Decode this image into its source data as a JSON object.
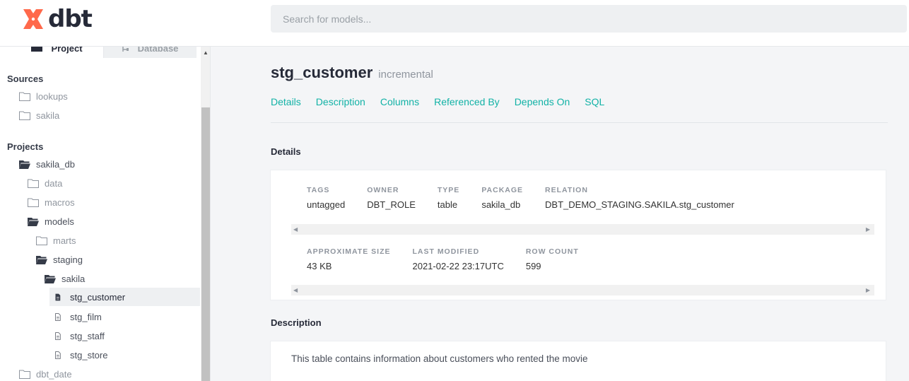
{
  "header": {
    "logo_text": "dbt",
    "search_placeholder": "Search for models..."
  },
  "sidebar": {
    "tabs": [
      {
        "label": "Project",
        "icon": "folder-icon"
      },
      {
        "label": "Database",
        "icon": "database-icon"
      }
    ],
    "sources_heading": "Sources",
    "sources": [
      "lookups",
      "sakila"
    ],
    "projects_heading": "Projects",
    "tree": {
      "sakila_db": "sakila_db",
      "data": "data",
      "macros": "macros",
      "models": "models",
      "marts": "marts",
      "staging": "staging",
      "sakila": "sakila",
      "stg_customer": "stg_customer",
      "stg_film": "stg_film",
      "stg_staff": "stg_staff",
      "stg_store": "stg_store",
      "dbt_date": "dbt_date"
    }
  },
  "main": {
    "model_name": "stg_customer",
    "model_type": "incremental",
    "nav": [
      "Details",
      "Description",
      "Columns",
      "Referenced By",
      "Depends On",
      "SQL"
    ],
    "details_title": "Details",
    "details": {
      "tags_label": "TAGS",
      "tags_value": "untagged",
      "owner_label": "OWNER",
      "owner_value": "DBT_ROLE",
      "type_label": "TYPE",
      "type_value": "table",
      "package_label": "PACKAGE",
      "package_value": "sakila_db",
      "relation_label": "RELATION",
      "relation_value": "DBT_DEMO_STAGING.SAKILA.stg_customer",
      "size_label": "APPROXIMATE SIZE",
      "size_value": "43 KB",
      "modified_label": "LAST MODIFIED",
      "modified_value": "2021-02-22 23:17UTC",
      "rows_label": "ROW COUNT",
      "rows_value": "599"
    },
    "description_title": "Description",
    "description_text": "This table contains information about customers who rented the movie"
  },
  "colors": {
    "accent": "#12b2a6",
    "brand": "#ff694b",
    "text_dark": "#262a38"
  }
}
